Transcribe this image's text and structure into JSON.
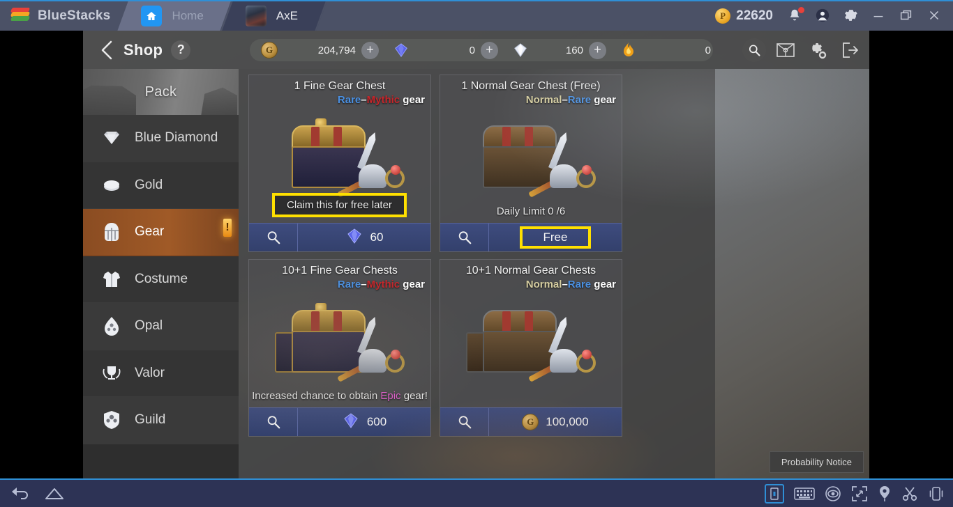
{
  "titlebar": {
    "brand": "BlueStacks",
    "tabs": [
      {
        "label": "Home",
        "icon": "home-icon"
      },
      {
        "label": "AxE",
        "icon": "axe-app-icon"
      }
    ],
    "points_value": "22620",
    "points_icon": "p-coin-icon",
    "icons": [
      "bell-icon",
      "account-icon",
      "gear-icon",
      "minimize-icon",
      "restore-icon",
      "close-icon"
    ]
  },
  "shop": {
    "back_icon": "back-chevron-icon",
    "title": "Shop",
    "help_label": "?",
    "currencies": [
      {
        "icon": "gold-coin-icon",
        "value": "204,794",
        "plus": "+"
      },
      {
        "icon": "blue-diamond-icon",
        "value": "0",
        "plus": "+"
      },
      {
        "icon": "white-diamond-icon",
        "value": "160",
        "plus": "+"
      },
      {
        "icon": "flame-icon",
        "value": "0",
        "plus": ""
      }
    ],
    "header_icons": [
      "search-icon",
      "map-icon",
      "settings-icon",
      "exit-icon"
    ]
  },
  "sidebar": {
    "banner_label": "Pack",
    "items": [
      {
        "label": "Blue Diamond",
        "icon": "diamond-icon",
        "active": false,
        "badge": ""
      },
      {
        "label": "Gold",
        "icon": "gold-icon",
        "active": false,
        "badge": ""
      },
      {
        "label": "Gear",
        "icon": "helmet-icon",
        "active": true,
        "badge": "!"
      },
      {
        "label": "Costume",
        "icon": "shirt-icon",
        "active": false,
        "badge": ""
      },
      {
        "label": "Opal",
        "icon": "opal-icon",
        "active": false,
        "badge": ""
      },
      {
        "label": "Valor",
        "icon": "trophy-icon",
        "active": false,
        "badge": ""
      },
      {
        "label": "Guild",
        "icon": "guild-shield-icon",
        "active": false,
        "badge": ""
      }
    ]
  },
  "cards": [
    {
      "title": "1 Fine Gear Chest",
      "rarity_low": "Rare",
      "rarity_high": "Mythic",
      "rarity_suffix": " gear",
      "rarity_low_class": "r-rare",
      "rarity_high_class": "r-mythic",
      "note": "",
      "highlight_text": "Claim this for free later",
      "price_icon": "blue-diamond-icon",
      "price": "60",
      "search_icon": "search-icon"
    },
    {
      "title": "1 Normal Gear Chest (Free)",
      "rarity_low": "Normal",
      "rarity_high": "Rare",
      "rarity_suffix": " gear",
      "rarity_low_class": "r-normal",
      "rarity_high_class": "r-rare",
      "note": "Daily Limit 0 /6",
      "highlight_text": "",
      "price_icon": "",
      "price": "Free",
      "search_icon": "search-icon"
    },
    {
      "title": "10+1 Fine Gear Chests",
      "rarity_low": "Rare",
      "rarity_high": "Mythic",
      "rarity_suffix": " gear",
      "rarity_low_class": "r-rare",
      "rarity_high_class": "r-mythic",
      "note_prefix": "Increased chance to obtain ",
      "note_accent": "Epic",
      "note_suffix": " gear!",
      "highlight_text": "",
      "price_icon": "blue-diamond-icon",
      "price": "600",
      "search_icon": "search-icon"
    },
    {
      "title": "10+1 Normal Gear Chests",
      "rarity_low": "Normal",
      "rarity_high": "Rare",
      "rarity_suffix": " gear",
      "rarity_low_class": "r-normal",
      "rarity_high_class": "r-rare",
      "note": "",
      "highlight_text": "",
      "price_icon": "gold-coin-icon",
      "price": "100,000",
      "search_icon": "search-icon"
    }
  ],
  "probability_notice": "Probability Notice",
  "bottombar": {
    "left_icons": [
      "back-icon",
      "home-icon"
    ],
    "right_icons": [
      "portrait-icon",
      "keyboard-icon",
      "eye-icon",
      "fullscreen-icon",
      "location-icon",
      "scissors-icon",
      "shake-icon"
    ]
  },
  "colors": {
    "accent_blue": "#2f8fd6",
    "highlight_yellow": "#ffe000",
    "active_orange": "#a05a27",
    "rare_blue": "#4a90e2",
    "mythic_red": "#c5262b",
    "normal_tan": "#d5cda0",
    "epic_pink": "#e35fd0"
  }
}
